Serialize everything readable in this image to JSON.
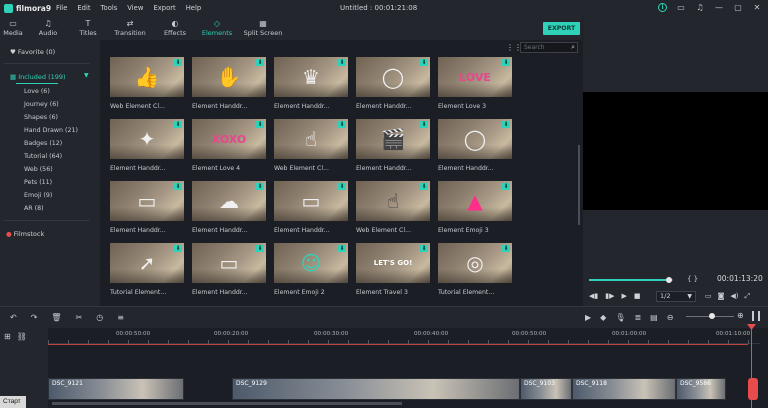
{
  "app": {
    "name": "filmora9",
    "window_title": "Untitled : 00:01:21:08"
  },
  "menu": [
    "File",
    "Edit",
    "Tools",
    "View",
    "Export",
    "Help"
  ],
  "window_icons": [
    "info-icon",
    "folder-icon",
    "bell-icon",
    "minimize-icon",
    "maximize-icon",
    "close-icon"
  ],
  "toolbar": {
    "tabs": [
      {
        "label": "Media",
        "icon": "folder-icon"
      },
      {
        "label": "Audio",
        "icon": "music-icon"
      },
      {
        "label": "Titles",
        "icon": "text-icon"
      },
      {
        "label": "Transition",
        "icon": "transition-icon"
      },
      {
        "label": "Effects",
        "icon": "effects-icon"
      },
      {
        "label": "Elements",
        "icon": "elements-icon"
      },
      {
        "label": "Split Screen",
        "icon": "split-screen-icon"
      }
    ],
    "active_tab": "Elements",
    "export_label": "EXPORT"
  },
  "sidebar": {
    "favorite": "Favorite (0)",
    "included": "Included (199)",
    "items": [
      {
        "label": "Love (6)"
      },
      {
        "label": "Journey (6)"
      },
      {
        "label": "Shapes (6)"
      },
      {
        "label": "Hand Drawn (21)"
      },
      {
        "label": "Badges (12)"
      },
      {
        "label": "Tutorial (64)"
      },
      {
        "label": "Web (56)"
      },
      {
        "label": "Pets (11)"
      },
      {
        "label": "Emoji (9)"
      },
      {
        "label": "AR (8)"
      }
    ],
    "filmstock": "Filmstock"
  },
  "search": {
    "placeholder": "Search"
  },
  "elements": [
    {
      "label": "Web Element Cl...",
      "motif": "👍",
      "color": "#ffffff"
    },
    {
      "label": "Element Handdr...",
      "motif": "✋",
      "color": "#f0f0f0"
    },
    {
      "label": "Element Handdr...",
      "motif": "♛",
      "color": "#f0f0f0"
    },
    {
      "label": "Element Handdr...",
      "motif": "◯",
      "color": "#f0f0f0"
    },
    {
      "label": "Element Love 3",
      "motif": "LOVE",
      "color": "#e8468c"
    },
    {
      "label": "Element Handdr...",
      "motif": "✦",
      "color": "#f0f0f0"
    },
    {
      "label": "Element Love 4",
      "motif": "XOXO",
      "color": "#e8468c"
    },
    {
      "label": "Web Element Cl...",
      "motif": "☝",
      "color": "#ffffff"
    },
    {
      "label": "Element Handdr...",
      "motif": "🎬",
      "color": "#f0f0f0"
    },
    {
      "label": "Element Handdr...",
      "motif": "◯",
      "color": "#f0f0f0"
    },
    {
      "label": "Element Handdr...",
      "motif": "▭",
      "color": "#f0f0f0"
    },
    {
      "label": "Element Handdr...",
      "motif": "☁",
      "color": "#f0f0f0"
    },
    {
      "label": "Element Handdr...",
      "motif": "▭",
      "color": "#f0f0f0"
    },
    {
      "label": "Web Element Cl...",
      "motif": "☝",
      "color": "#333333"
    },
    {
      "label": "Element Emoji 3",
      "motif": "▲",
      "color": "#ff2e8a"
    },
    {
      "label": "Tutorial Element...",
      "motif": "➚",
      "color": "#f0f0f0"
    },
    {
      "label": "Element Handdr...",
      "motif": "▭",
      "color": "#f0f0f0"
    },
    {
      "label": "Element Emoji 2",
      "motif": "☺",
      "color": "#2fd2b8"
    },
    {
      "label": "Element Travel 3",
      "motif": "LET'S GO!",
      "color": "#ffffff"
    },
    {
      "label": "Tutorial Element...",
      "motif": "◎",
      "color": "#f0f0f0"
    }
  ],
  "preview": {
    "timecode": "00:01:13:20",
    "brackets": "{  }",
    "ratio": "1/2",
    "progress": 0.95
  },
  "timeline": {
    "ruler": [
      "00:00:50:00",
      "00:00:20:00",
      "00:00:30:00",
      "00:00:40:00",
      "00:00:50:00",
      "00:01:00:00",
      "00:01:10:00"
    ],
    "clips": [
      {
        "name": "DSC_9121"
      },
      {
        "name": "DSC_9129"
      },
      {
        "name": "DSC_9103"
      },
      {
        "name": "DSC_9118"
      },
      {
        "name": "DSC_9586"
      }
    ],
    "zoom_level": 0.55
  },
  "taskbar": {
    "start": "Старт"
  }
}
